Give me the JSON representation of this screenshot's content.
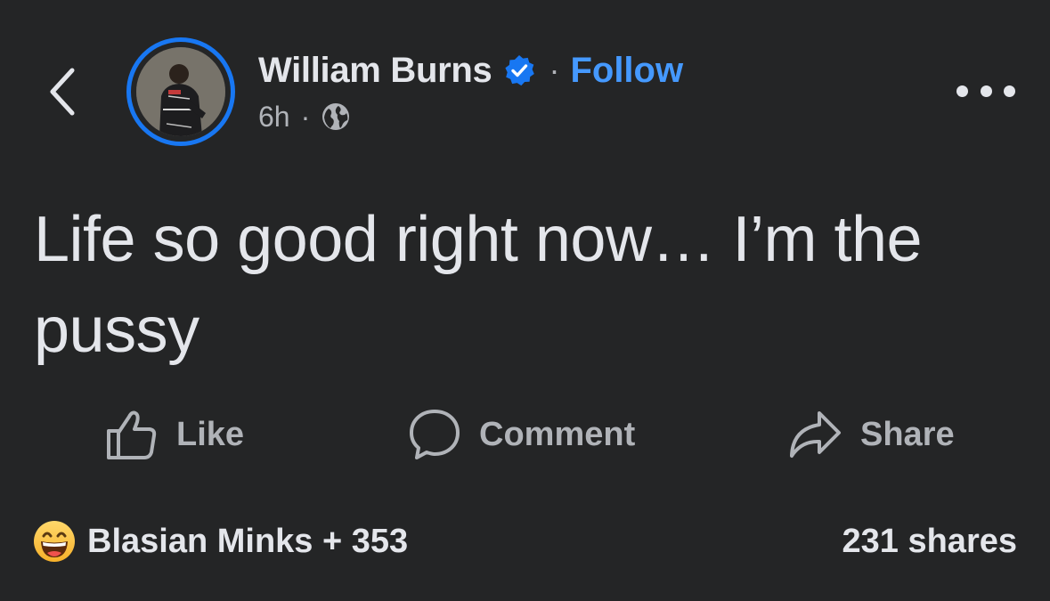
{
  "header": {
    "author_name": "William Burns",
    "separator": "·",
    "follow_label": "Follow",
    "time": "6h",
    "meta_separator": "·",
    "verified_icon": "verified-badge-icon",
    "privacy_icon": "globe-icon",
    "accent_color": "#1877f2",
    "follow_color": "#4599ff"
  },
  "post": {
    "text": "Life so good right now… I’m the pussy"
  },
  "actions": {
    "like_label": "Like",
    "comment_label": "Comment",
    "share_label": "Share"
  },
  "footer": {
    "reactions_summary": "Blasian Minks + 353",
    "reaction_icon": "grinning-emoji-icon",
    "shares": "231 shares"
  },
  "colors": {
    "background": "#242526",
    "primary_text": "#e4e6eb",
    "secondary_text": "#b0b3b8"
  }
}
